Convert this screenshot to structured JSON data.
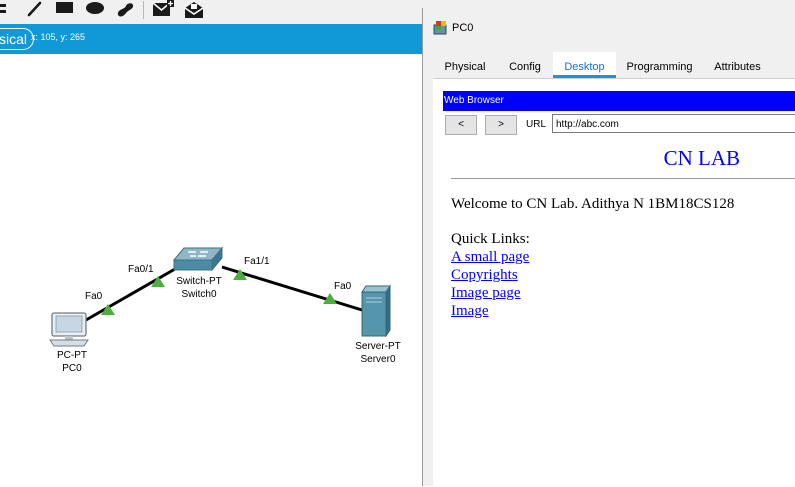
{
  "toolbar": {
    "tools": [
      "select-line-icon",
      "pencil-icon",
      "rectangle-icon",
      "ellipse-icon",
      "freeform-icon",
      "add-simple-pdu-icon",
      "add-complex-pdu-icon"
    ]
  },
  "modebar": {
    "mode_label": "sical",
    "coords": "x: 105, y: 265"
  },
  "topology": {
    "devices": [
      {
        "id": "pc",
        "type_label": "PC-PT",
        "name": "PC0"
      },
      {
        "id": "switch",
        "type_label": "Switch-PT",
        "name": "Switch0"
      },
      {
        "id": "server",
        "type_label": "Server-PT",
        "name": "Server0"
      }
    ],
    "ports": {
      "pc_port": "Fa0",
      "switch_port_left": "Fa0/1",
      "switch_port_right": "Fa1/1",
      "server_port": "Fa0"
    },
    "link_status_color": "#4cae3c"
  },
  "window": {
    "title": "PC0",
    "tabs": [
      "Physical",
      "Config",
      "Desktop",
      "Programming",
      "Attributes"
    ],
    "active_tab": "Desktop"
  },
  "browser": {
    "title": "Web Browser",
    "back_label": "<",
    "forward_label": ">",
    "url_label": "URL",
    "url_value": "http://abc.com",
    "page": {
      "heading": "CN LAB",
      "welcome": "Welcome to CN Lab. Adithya N 1BM18CS128",
      "quick_links_label": "Quick Links:",
      "links": [
        "A small page",
        "Copyrights",
        "Image page",
        "Image"
      ]
    }
  },
  "colors": {
    "modebar": "#1198d6",
    "browser_titlebar": "#0000ff",
    "link": "#0000ff"
  }
}
